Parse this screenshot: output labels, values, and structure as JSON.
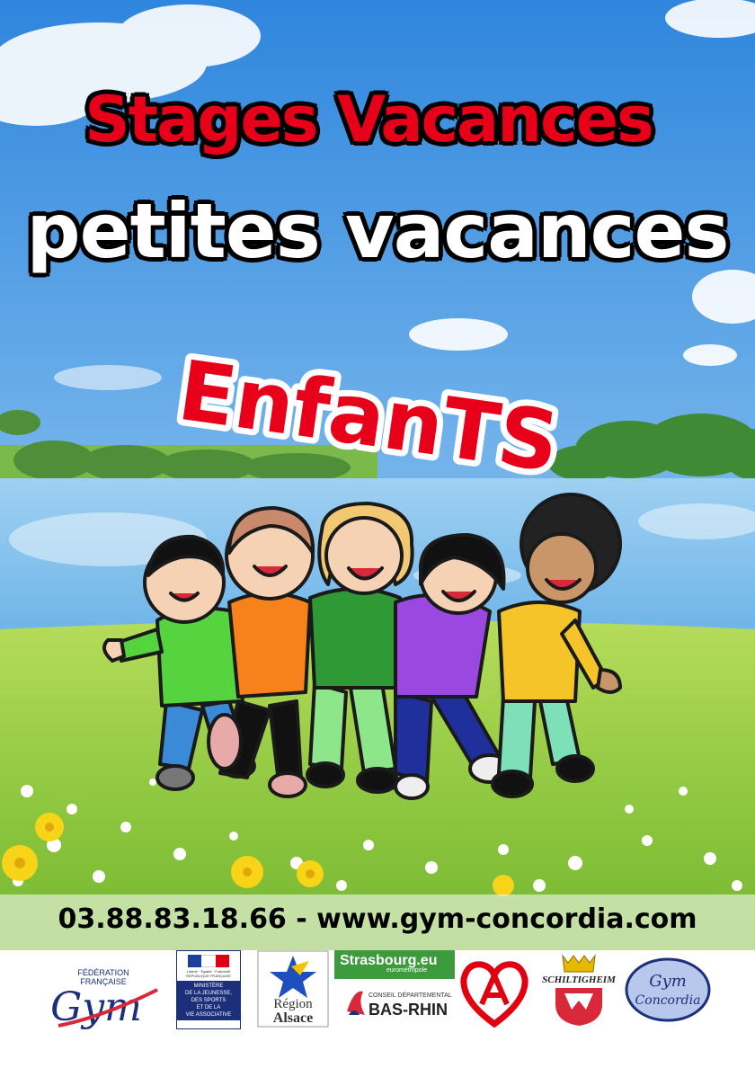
{
  "poster": {
    "title_line1": "Stages Vacances",
    "title_line2": "petites vacances",
    "audience": "EnfanTS",
    "contact": "03.88.83.18.66 - www.gym-concordia.com"
  },
  "logos": {
    "ffg_top": "FÉDÉRATION",
    "ffg_mid": "FRANÇAISE",
    "ffg_name": "Gym",
    "ministere_motto": "Liberté · Égalité · Fraternité",
    "ministere_rep": "RÉPUBLIQUE FRANÇAISE",
    "ministere_lines": [
      "MINISTÈRE",
      "DE LA JEUNESSE,",
      "DES SPORTS",
      "ET DE LA",
      "VIE ASSOCIATIVE"
    ],
    "region_line1": "Région",
    "region_line2": "Alsace",
    "strasbourg_name": "Strasbourg.eu",
    "strasbourg_sub": "eurométropole",
    "basrhin_sub": "CONSEIL DÉPARTEMENTAL",
    "basrhin_name": "BAS-RHIN",
    "schiltigheim": "SCHILTIGHEIM",
    "concordia_1": "Gym",
    "concordia_2": "Concordia"
  },
  "colors": {
    "title_red": "#e8001a",
    "sky_top": "#3b8fe0",
    "grass": "#8cc63f"
  }
}
